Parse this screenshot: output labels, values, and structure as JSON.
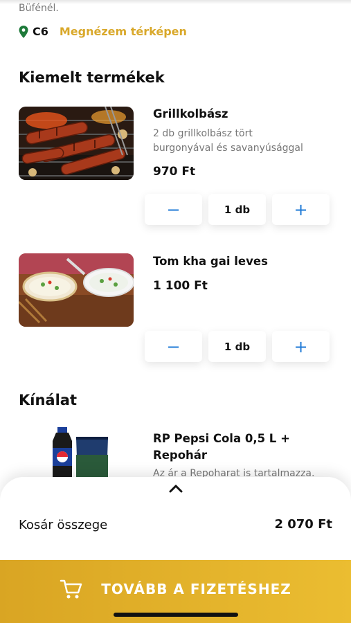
{
  "header": {
    "intro_text": "Büfénél.",
    "location_code": "C6",
    "map_link": "Megnézem térképen"
  },
  "featured": {
    "title": "Kiemelt termékek",
    "items": [
      {
        "name": "Grillkolbász",
        "desc_line1": "2 db grillkolbász tört",
        "desc_line2": "burgonyával és savanyúsággal",
        "price": "970 Ft",
        "qty": "1 db",
        "minus": "−",
        "plus": "+"
      },
      {
        "name": "Tom kha gai leves",
        "price": "1 100 Ft",
        "qty": "1 db",
        "minus": "−",
        "plus": "+"
      }
    ]
  },
  "offer": {
    "title": "Kínálat",
    "items": [
      {
        "name_line1": "RP Pepsi Cola 0,5 L +",
        "name_line2": "Repohár",
        "desc": "Az ár a Repoharat is tartalmazza."
      }
    ]
  },
  "cart": {
    "total_label": "Kosár összege",
    "total_value": "2 070 Ft",
    "checkout_label": "TOVÁBB A FIZETÉSHEZ"
  },
  "colors": {
    "accent": "#d9a82a",
    "pin": "#1e7a3a",
    "stepper_icon": "#1f7ad6",
    "checkout_bg": "#e1b02a"
  }
}
